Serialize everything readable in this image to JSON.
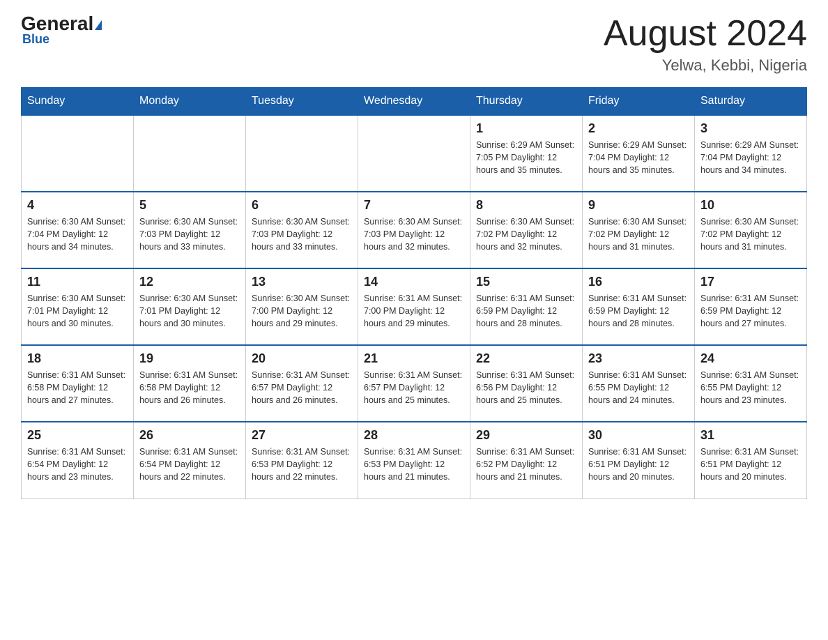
{
  "header": {
    "logo_general": "General",
    "logo_blue": "Blue",
    "title": "August 2024",
    "subtitle": "Yelwa, Kebbi, Nigeria"
  },
  "days_of_week": [
    "Sunday",
    "Monday",
    "Tuesday",
    "Wednesday",
    "Thursday",
    "Friday",
    "Saturday"
  ],
  "weeks": [
    [
      {
        "day": "",
        "info": ""
      },
      {
        "day": "",
        "info": ""
      },
      {
        "day": "",
        "info": ""
      },
      {
        "day": "",
        "info": ""
      },
      {
        "day": "1",
        "info": "Sunrise: 6:29 AM\nSunset: 7:05 PM\nDaylight: 12 hours\nand 35 minutes."
      },
      {
        "day": "2",
        "info": "Sunrise: 6:29 AM\nSunset: 7:04 PM\nDaylight: 12 hours\nand 35 minutes."
      },
      {
        "day": "3",
        "info": "Sunrise: 6:29 AM\nSunset: 7:04 PM\nDaylight: 12 hours\nand 34 minutes."
      }
    ],
    [
      {
        "day": "4",
        "info": "Sunrise: 6:30 AM\nSunset: 7:04 PM\nDaylight: 12 hours\nand 34 minutes."
      },
      {
        "day": "5",
        "info": "Sunrise: 6:30 AM\nSunset: 7:03 PM\nDaylight: 12 hours\nand 33 minutes."
      },
      {
        "day": "6",
        "info": "Sunrise: 6:30 AM\nSunset: 7:03 PM\nDaylight: 12 hours\nand 33 minutes."
      },
      {
        "day": "7",
        "info": "Sunrise: 6:30 AM\nSunset: 7:03 PM\nDaylight: 12 hours\nand 32 minutes."
      },
      {
        "day": "8",
        "info": "Sunrise: 6:30 AM\nSunset: 7:02 PM\nDaylight: 12 hours\nand 32 minutes."
      },
      {
        "day": "9",
        "info": "Sunrise: 6:30 AM\nSunset: 7:02 PM\nDaylight: 12 hours\nand 31 minutes."
      },
      {
        "day": "10",
        "info": "Sunrise: 6:30 AM\nSunset: 7:02 PM\nDaylight: 12 hours\nand 31 minutes."
      }
    ],
    [
      {
        "day": "11",
        "info": "Sunrise: 6:30 AM\nSunset: 7:01 PM\nDaylight: 12 hours\nand 30 minutes."
      },
      {
        "day": "12",
        "info": "Sunrise: 6:30 AM\nSunset: 7:01 PM\nDaylight: 12 hours\nand 30 minutes."
      },
      {
        "day": "13",
        "info": "Sunrise: 6:30 AM\nSunset: 7:00 PM\nDaylight: 12 hours\nand 29 minutes."
      },
      {
        "day": "14",
        "info": "Sunrise: 6:31 AM\nSunset: 7:00 PM\nDaylight: 12 hours\nand 29 minutes."
      },
      {
        "day": "15",
        "info": "Sunrise: 6:31 AM\nSunset: 6:59 PM\nDaylight: 12 hours\nand 28 minutes."
      },
      {
        "day": "16",
        "info": "Sunrise: 6:31 AM\nSunset: 6:59 PM\nDaylight: 12 hours\nand 28 minutes."
      },
      {
        "day": "17",
        "info": "Sunrise: 6:31 AM\nSunset: 6:59 PM\nDaylight: 12 hours\nand 27 minutes."
      }
    ],
    [
      {
        "day": "18",
        "info": "Sunrise: 6:31 AM\nSunset: 6:58 PM\nDaylight: 12 hours\nand 27 minutes."
      },
      {
        "day": "19",
        "info": "Sunrise: 6:31 AM\nSunset: 6:58 PM\nDaylight: 12 hours\nand 26 minutes."
      },
      {
        "day": "20",
        "info": "Sunrise: 6:31 AM\nSunset: 6:57 PM\nDaylight: 12 hours\nand 26 minutes."
      },
      {
        "day": "21",
        "info": "Sunrise: 6:31 AM\nSunset: 6:57 PM\nDaylight: 12 hours\nand 25 minutes."
      },
      {
        "day": "22",
        "info": "Sunrise: 6:31 AM\nSunset: 6:56 PM\nDaylight: 12 hours\nand 25 minutes."
      },
      {
        "day": "23",
        "info": "Sunrise: 6:31 AM\nSunset: 6:55 PM\nDaylight: 12 hours\nand 24 minutes."
      },
      {
        "day": "24",
        "info": "Sunrise: 6:31 AM\nSunset: 6:55 PM\nDaylight: 12 hours\nand 23 minutes."
      }
    ],
    [
      {
        "day": "25",
        "info": "Sunrise: 6:31 AM\nSunset: 6:54 PM\nDaylight: 12 hours\nand 23 minutes."
      },
      {
        "day": "26",
        "info": "Sunrise: 6:31 AM\nSunset: 6:54 PM\nDaylight: 12 hours\nand 22 minutes."
      },
      {
        "day": "27",
        "info": "Sunrise: 6:31 AM\nSunset: 6:53 PM\nDaylight: 12 hours\nand 22 minutes."
      },
      {
        "day": "28",
        "info": "Sunrise: 6:31 AM\nSunset: 6:53 PM\nDaylight: 12 hours\nand 21 minutes."
      },
      {
        "day": "29",
        "info": "Sunrise: 6:31 AM\nSunset: 6:52 PM\nDaylight: 12 hours\nand 21 minutes."
      },
      {
        "day": "30",
        "info": "Sunrise: 6:31 AM\nSunset: 6:51 PM\nDaylight: 12 hours\nand 20 minutes."
      },
      {
        "day": "31",
        "info": "Sunrise: 6:31 AM\nSunset: 6:51 PM\nDaylight: 12 hours\nand 20 minutes."
      }
    ]
  ]
}
